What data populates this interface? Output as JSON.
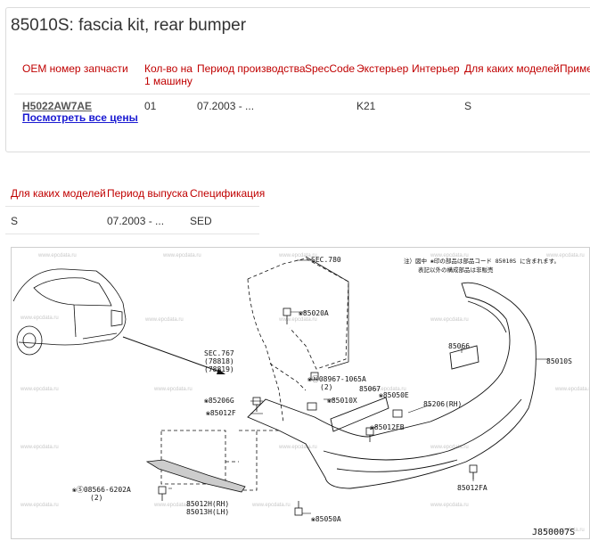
{
  "page": {
    "title": "85010S: fascia kit, rear bumper"
  },
  "parts_table": {
    "headers": [
      "OEM номер запчасти",
      "Кол-во на\n1 машину",
      "Период производства",
      "SpecCode",
      "Экстерьер",
      "Интерьер",
      "Для каких моделей",
      "Примеч"
    ],
    "row": {
      "oem": "H5022AW7AE",
      "all_prices_link": "Посмотреть все цены",
      "qty": "01",
      "period": "07.2003 - ...",
      "speccode": "",
      "exterior": "K21",
      "interior": "",
      "models": "S",
      "note": ""
    }
  },
  "models_table": {
    "headers": [
      "Для каких моделей",
      "Период выпуска",
      "Спецификация"
    ],
    "row": {
      "models": "S",
      "period": "07.2003 - ...",
      "spec": "SED"
    }
  },
  "diagram": {
    "note_line1": "注）図中 ❀印の部品は部品コード 85010S に含まれます。",
    "note_line2": "表記以外の構成部品は非販売",
    "watermark": "www.epcdata.ru",
    "code": "J850007S",
    "labels": {
      "sec780": "SEC.780",
      "p85020A": "❀85020A",
      "sec767": "SEC.767",
      "sec767a": "(78818)",
      "sec767b": "(78819)",
      "p08967": "❀Ⓝ08967-1065A",
      "p08967q": "(2)",
      "p85067": "85067",
      "p85066": "85066",
      "p85010S": "85010S",
      "p85206G": "❀85206G",
      "p85012F": "❀85012F",
      "p85010X": "❀85010X",
      "p85050E": "❀85050E",
      "p85206RH": "85206(RH)",
      "p85012FB": "❀85012FB",
      "p08566": "❀Ⓢ08566-6202A",
      "p08566q": "(2)",
      "p85012H": "85012H(RH)",
      "p85013H": "85013H(LH)",
      "p85012FA": "85012FA",
      "p85050A": "❀85050A"
    }
  }
}
